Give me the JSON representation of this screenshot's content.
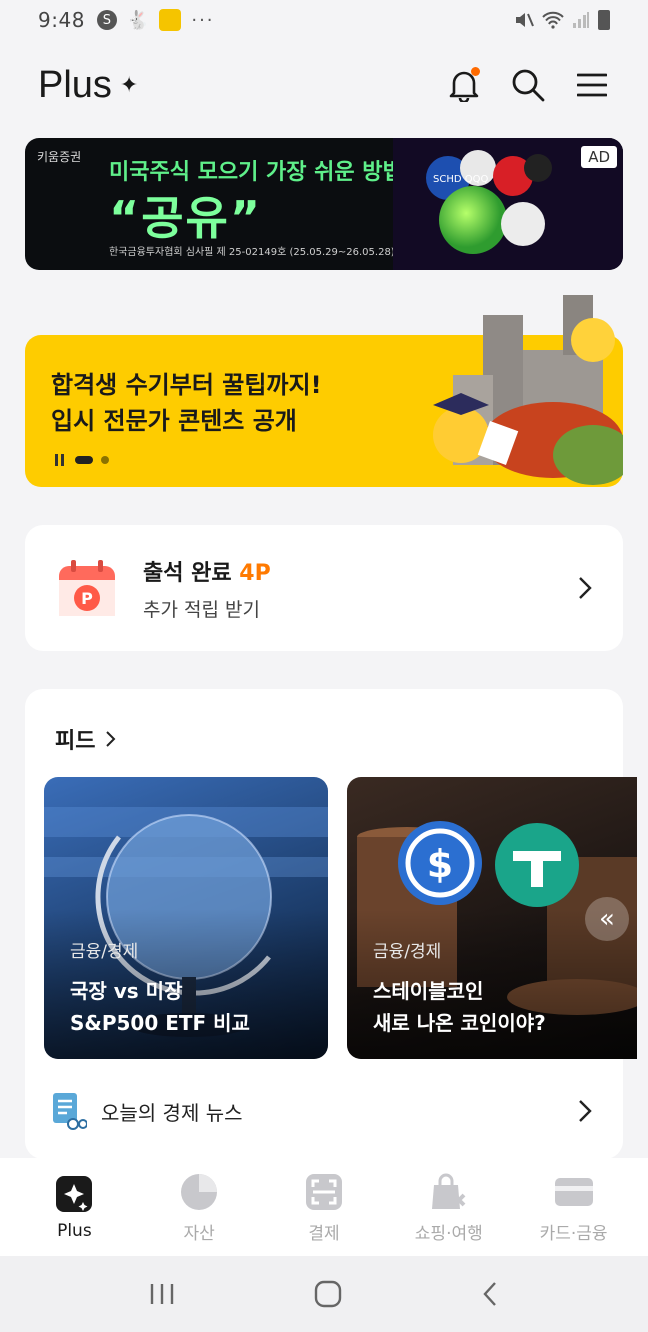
{
  "status": {
    "time": "9:48",
    "badge": "S"
  },
  "header": {
    "brand": "Plus",
    "spark": "✦"
  },
  "ad": {
    "brand": "키움증권",
    "title": "미국주식 모으기 가장 쉬운 방법 :",
    "big": "“공유”",
    "disclaimer": "한국금융투자협회 심사필 제 25-02149호 (25.05.29~26.05.28)",
    "tag": "AD",
    "coin_label": "SCHD QQQ"
  },
  "banner": {
    "line1": "합격생 수기부터 꿀팁까지!",
    "line2": "입시 전문가 콘텐츠 공개"
  },
  "attendance": {
    "title": "출석 완료",
    "points": "4P",
    "subtitle": "추가 적립 받기",
    "badge": "P"
  },
  "feed": {
    "title": "피드",
    "cards": [
      {
        "category": "금융/경제",
        "line1": "국장 vs 미장",
        "line2": "S&P500 ETF 비교"
      },
      {
        "category": "금융/경제",
        "line1": "스테이블코인",
        "line2": "새로 나온 코인이야?"
      }
    ],
    "scroll_hint": "«",
    "news_label": "오늘의 경제 뉴스"
  },
  "tabs": [
    {
      "label": "Plus",
      "icon": "plus-spark-icon"
    },
    {
      "label": "자산",
      "icon": "pie-chart-icon"
    },
    {
      "label": "결제",
      "icon": "scan-pay-icon"
    },
    {
      "label": "쇼핑·여행",
      "icon": "shopping-bag-icon"
    },
    {
      "label": "카드·금융",
      "icon": "card-icon"
    }
  ],
  "colors": {
    "accent": "#ff7a00",
    "banner": "#fecc00",
    "ad_text": "#7dff9c"
  }
}
